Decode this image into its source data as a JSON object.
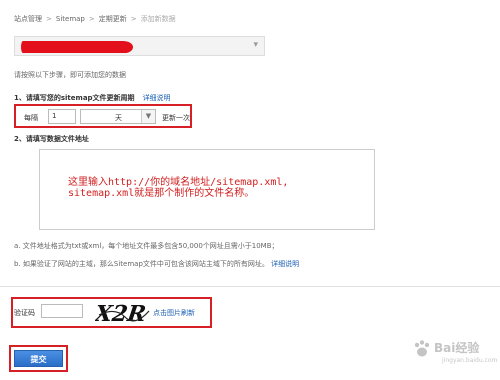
{
  "breadcrumb": {
    "items": [
      "站点管理",
      "Sitemap",
      "定期更新"
    ],
    "current": "添加新数据",
    "separator": ">"
  },
  "site_select": {
    "arrow": "▾"
  },
  "hint": "请按照以下步骤，即可添加您的数据",
  "step1": {
    "title": "1、请填写您的sitemap文件更新周期",
    "help_link": "详细说明",
    "every_label": "每隔",
    "number_value": "1",
    "unit_value": "天",
    "after_label": "更新一次"
  },
  "step2": {
    "title": "2、请填写数据文件地址",
    "textarea_text": "这里输入http://你的域名地址/sitemap.xml,\nsitemap.xml就是那个制作的文件名称。"
  },
  "notes": {
    "a": "a. 文件地址格式为txt或xml，每个地址文件最多包含50,000个网址且需小于10MB；",
    "b": "b. 如果验证了网站的主域，那么Sitemap文件中可包含该网站主域下的所有网址。",
    "b_link": "详细说明"
  },
  "captcha": {
    "label": "验证码",
    "input_value": "",
    "image_text": "X2R",
    "refresh_link": "点击图片刷新"
  },
  "submit_label": "提交",
  "watermark": {
    "brand": "Bai经验",
    "url": "jingyan.baidu.com"
  },
  "colors": {
    "highlight_border": "#d71f26",
    "link": "#1a5fb4",
    "redaction": "#e3101b",
    "annotation": "#d21e1e"
  }
}
